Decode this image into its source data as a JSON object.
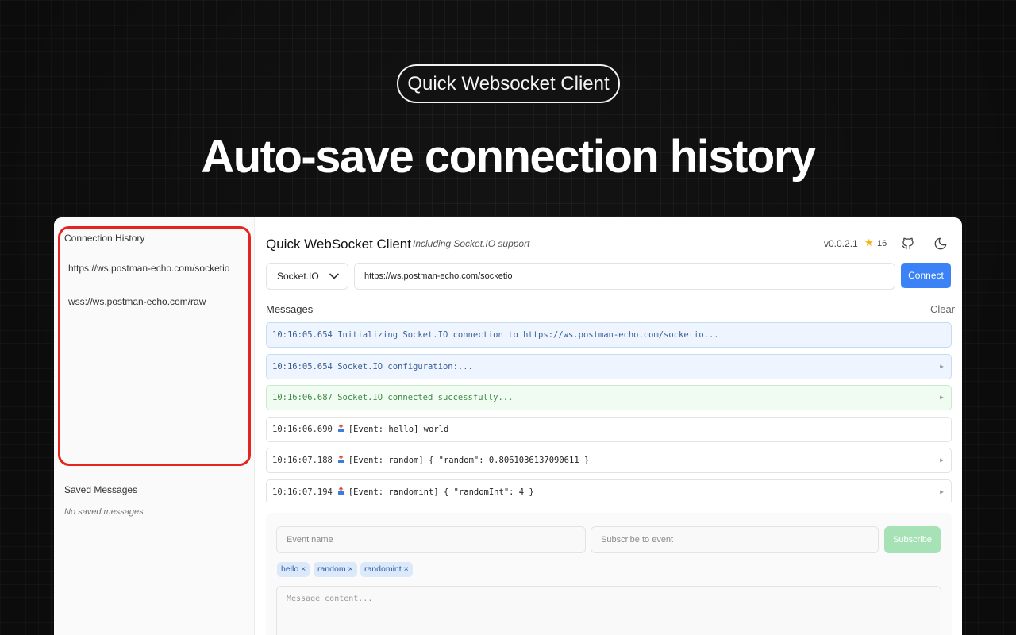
{
  "banner": {
    "pill_label": "Quick Websocket Client",
    "headline": "Auto-save connection history"
  },
  "sidebar": {
    "history_title": "Connection History",
    "history_items": [
      "https://ws.postman-echo.com/socketio",
      "wss://ws.postman-echo.com/raw"
    ],
    "saved_title": "Saved Messages",
    "saved_empty": "No saved messages",
    "highlight_color": "#e52420"
  },
  "header": {
    "title": "Quick WebSocket Client",
    "subtitle": "Including Socket.IO support",
    "version": "v0.0.2.1",
    "stars": "16",
    "icons": [
      "star-icon",
      "github-icon",
      "moon-icon"
    ]
  },
  "connection": {
    "protocol": "Socket.IO",
    "url": "https://ws.postman-echo.com/socketio",
    "connect_label": "Connect",
    "accent_color": "#3b82f6"
  },
  "messages": {
    "label": "Messages",
    "clear_label": "Clear",
    "items": [
      {
        "time": "10:16:05.654",
        "text": "Initializing Socket.IO connection to https://ws.postman-echo.com/socketio...",
        "kind": "info",
        "expandable": false,
        "event_icon": false
      },
      {
        "time": "10:16:05.654",
        "text": "Socket.IO configuration:...",
        "kind": "info",
        "expandable": true,
        "event_icon": false
      },
      {
        "time": "10:16:06.687",
        "text": "Socket.IO connected successfully...",
        "kind": "success",
        "expandable": true,
        "event_icon": false
      },
      {
        "time": "10:16:06.690",
        "text": "[Event: hello] world",
        "kind": "plain",
        "expandable": false,
        "event_icon": true
      },
      {
        "time": "10:16:07.188",
        "text": "[Event: random] { \"random\": 0.8061036137090611 }",
        "kind": "plain",
        "expandable": true,
        "event_icon": true
      },
      {
        "time": "10:16:07.194",
        "text": "[Event: randomint] { \"randomInt\": 4 }",
        "kind": "plain",
        "expandable": true,
        "event_icon": true
      }
    ]
  },
  "composer": {
    "event_name_placeholder": "Event name",
    "subscribe_placeholder": "Subscribe to event",
    "subscribe_label": "Subscribe",
    "tags": [
      "hello ×",
      "random ×",
      "randomint ×"
    ],
    "message_placeholder": "Message content..."
  }
}
